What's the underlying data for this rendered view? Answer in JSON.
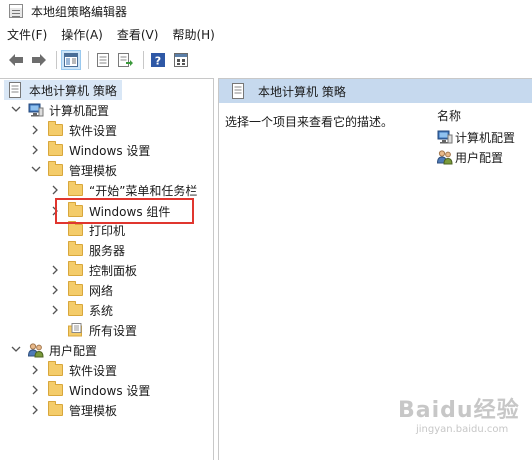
{
  "window": {
    "title": "本地组策略编辑器"
  },
  "menu": [
    {
      "label": "文件(F)"
    },
    {
      "label": "操作(A)"
    },
    {
      "label": "查看(V)"
    },
    {
      "label": "帮助(H)"
    }
  ],
  "toolbar": {
    "icons": [
      "back-arrow-icon",
      "forward-arrow-icon",
      "show-tree-icon",
      "properties-icon",
      "export-icon",
      "help-icon",
      "filter-icon"
    ]
  },
  "tree": {
    "root": "本地计算机 策略",
    "computer_config": "计算机配置",
    "cc_software": "软件设置",
    "cc_windows": "Windows 设置",
    "cc_admin": "管理模板",
    "start_menu": "“开始”菜单和任务栏",
    "windows_components": "Windows 组件",
    "printers": "打印机",
    "servers": "服务器",
    "control_panel": "控制面板",
    "network": "网络",
    "system": "系统",
    "all_settings": "所有设置",
    "user_config": "用户配置",
    "uc_software": "软件设置",
    "uc_windows": "Windows 设置",
    "uc_admin": "管理模板"
  },
  "right_pane": {
    "header": "本地计算机 策略",
    "description": "选择一个项目来查看它的描述。",
    "column_name": "名称",
    "items": [
      {
        "label": "计算机配置"
      },
      {
        "label": "用户配置"
      }
    ]
  },
  "watermark": {
    "main": "Baidu经验",
    "sub": "jingyan.baidu.com"
  },
  "colors": {
    "header_bg": "#c6d9ee",
    "selection_highlight": "#e0362f",
    "folder": "#f4cc6a"
  }
}
